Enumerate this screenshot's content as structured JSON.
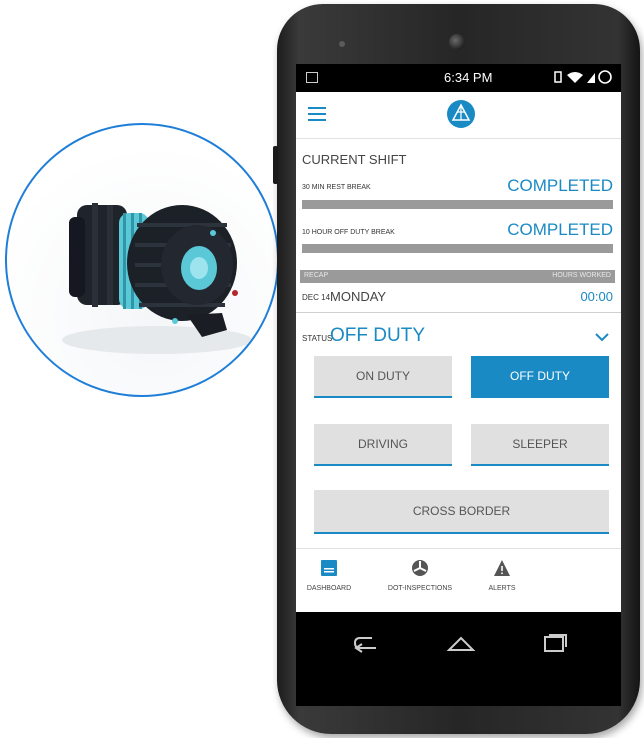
{
  "status_bar": {
    "time": "6:34 PM",
    "icons": "vibrate wifi signal battery"
  },
  "header": {
    "menu_icon": "hamburger-icon",
    "logo_icon": "app-logo"
  },
  "current_shift": {
    "title": "CURRENT SHIFT",
    "rows": [
      {
        "label": "30 MIN REST BREAK",
        "status": "COMPLETED"
      },
      {
        "label": "10 HOUR OFF DUTY BREAK",
        "status": "COMPLETED"
      }
    ]
  },
  "recap": {
    "left_label": "RECAP",
    "right_label": "HOURS WORKED",
    "date_small": "DEC 14",
    "day": "MONDAY",
    "hours": "00:00"
  },
  "status": {
    "label": "STATUS",
    "value": "OFF DUTY"
  },
  "duty_buttons": {
    "on_duty": "ON DUTY",
    "off_duty": "OFF DUTY",
    "driving": "DRIVING",
    "sleeper": "SLEEPER",
    "cross_border": "CROSS BORDER",
    "active": "off_duty"
  },
  "tabs": [
    {
      "label": "DASHBOARD",
      "icon": "dashboard-icon"
    },
    {
      "label": "DOT-INSPECTIONS",
      "icon": "inspection-icon"
    },
    {
      "label": "ALERTS",
      "icon": "alert-icon"
    }
  ],
  "nav": {
    "back": "back-icon",
    "home": "home-icon",
    "recents": "recents-icon"
  },
  "colors": {
    "accent": "#1a8ac4",
    "circle_border": "#1f7ed8",
    "button_bg": "#e0e0e0",
    "bar": "#9a9a9a"
  }
}
